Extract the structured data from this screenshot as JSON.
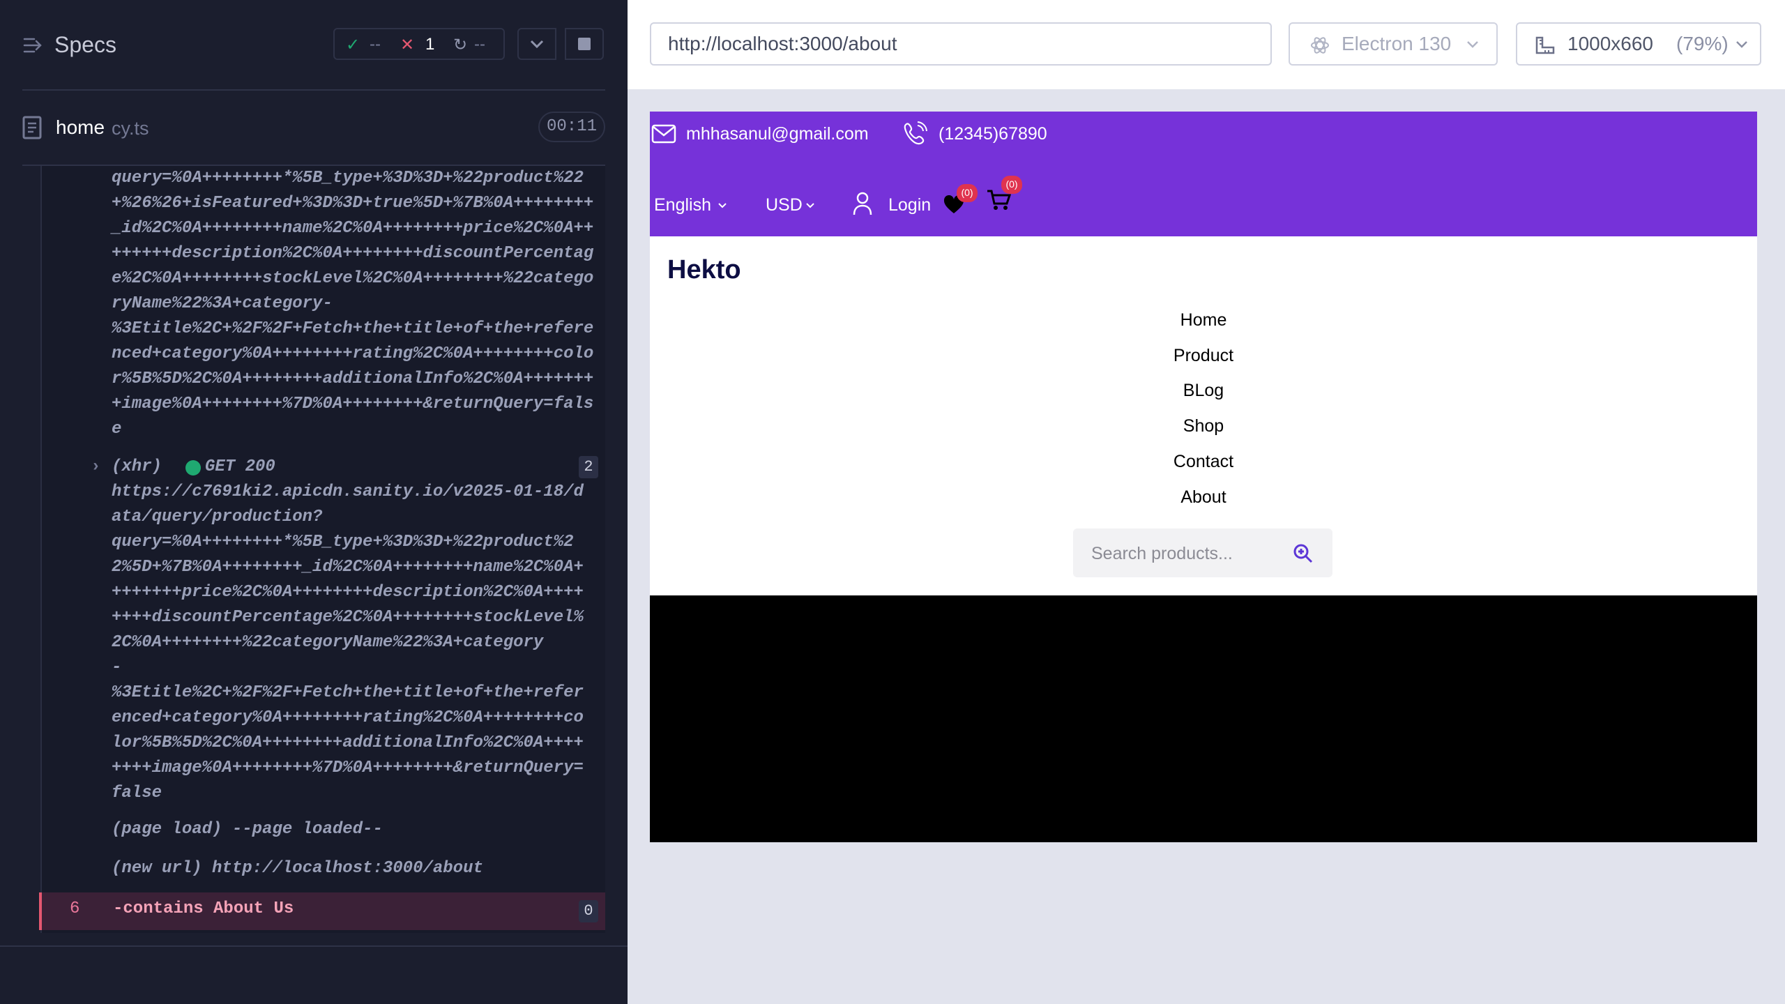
{
  "runner": {
    "specs_title": "Specs",
    "stats": {
      "passed": "--",
      "failed": "1",
      "pending": "--"
    },
    "spec_file": {
      "name": "home",
      "ext": "cy.ts",
      "duration": "00:11"
    },
    "log": {
      "request1_url_tail": "query=%0A++++++++*%5B_type+%3D%3D+%22product%22+%26%26+isFeatured+%3D%3D+true%5D+%7B%0A++++++++_id%2C%0A++++++++name%2C%0A++++++++price%2C%0A++++++++description%2C%0A++++++++discountPercentage%2C%0A++++++++stockLevel%2C%0A++++++++%22categoryName%22%3A+category-\n%3Etitle%2C+%2F%2F+Fetch+the+title+of+the+referenced+category%0A++++++++rating%2C%0A++++++++color%5B%5D%2C%0A++++++++additionalInfo%2C%0A++++++++image%0A++++++++%7D%0A++++++++&returnQuery=false",
      "request2_type": "(xhr)",
      "request2_status": "GET 200",
      "request2_count": "2",
      "request2_url": "https://c7691ki2.apicdn.sanity.io/v2025-01-18/data/query/production?\nquery=%0A++++++++*%5B_type+%3D%3D+%22product%22%5D+%7B%0A++++++++_id%2C%0A++++++++name%2C%0A++++++++price%2C%0A++++++++description%2C%0A++++++++discountPercentage%2C%0A++++++++stockLevel%2C%0A++++++++%22categoryName%22%3A+category\n-\n%3Etitle%2C+%2F%2F+Fetch+the+title+of+the+referenced+category%0A++++++++rating%2C%0A++++++++color%5B%5D%2C%0A++++++++additionalInfo%2C%0A++++++++image%0A++++++++%7D%0A++++++++&returnQuery=false",
      "page_load": "(page load)  --page loaded--",
      "new_url": "(new url)  http://localhost:3000/about",
      "fail_number": "6",
      "fail_command": "-contains  About Us",
      "fail_count": "0"
    }
  },
  "toolbar": {
    "url": "http://localhost:3000/about",
    "browser": "Electron 130",
    "viewport": "1000x660",
    "scale": "(79%)"
  },
  "app": {
    "email": "mhhasanul@gmail.com",
    "phone": "(12345)67890",
    "language": "English",
    "currency": "USD",
    "login": "Login",
    "wishlist_count": "(0)",
    "cart_count": "(0)",
    "brand": "Hekto",
    "nav": [
      "Home",
      "Product",
      "BLog",
      "Shop",
      "Contact",
      "About"
    ],
    "search_placeholder": "Search products..."
  },
  "colors": {
    "panel_bg": "#1b1e2e",
    "app_header": "#7632d9",
    "fail_accent": "#e45770",
    "badge": "#fb2e86"
  }
}
